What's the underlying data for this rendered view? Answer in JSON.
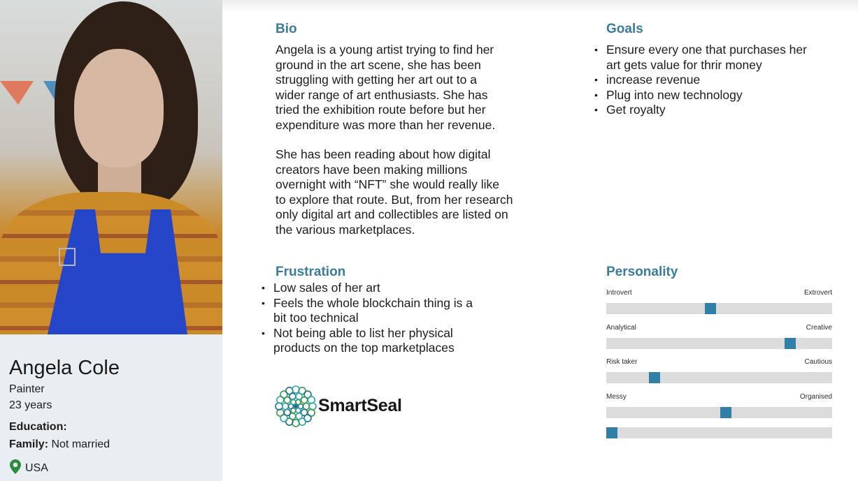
{
  "persona": {
    "name": "Angela Cole",
    "occupation": "Painter",
    "age": "23 years",
    "education_label": "Education:",
    "family_label": "Family:",
    "family_value": "Not married",
    "location": "USA"
  },
  "bio": {
    "heading": "Bio",
    "lines_p1": [
      "Angela is a young artist trying to find her",
      "ground in the art scene, she has been",
      "struggling with getting her art out to a",
      "wider range of art enthusiasts. She has",
      "tried the exhibition route before but her",
      "expenditure was more than her revenue."
    ],
    "lines_p2": [
      "She has been reading about how digital",
      "creators have been making millions",
      "overnight with “NFT” she would really like",
      "to explore that route. But, from her research",
      "only digital art and collectibles are listed on",
      "the various marketplaces."
    ]
  },
  "goals": {
    "heading": "Goals",
    "items": [
      [
        "Ensure every one that purchases her",
        "art gets value for thrir money"
      ],
      [
        "increase revenue"
      ],
      [
        "Plug into new technology"
      ],
      [
        "Get royalty"
      ]
    ]
  },
  "frustration": {
    "heading": "Frustration",
    "items": [
      [
        "Low sales of her art"
      ],
      [
        "Feels the whole blockchain thing is a",
        "bit too technical"
      ],
      [
        "Not being able to list her physical",
        "products on the top marketplaces"
      ]
    ]
  },
  "logo": {
    "text": "SmartSeal",
    "colors": [
      "#2aa6b3",
      "#3a9b4a",
      "#1d6f8e"
    ]
  },
  "personality": {
    "heading": "Personality",
    "accent": "#2f7fa6",
    "sliders": [
      {
        "left": "Introvert",
        "right": "Extrovert",
        "value": 0.46
      },
      {
        "left": "Analytical",
        "right": "Creative",
        "value": 0.83
      },
      {
        "left": "Risk taker",
        "right": "Cautious",
        "value": 0.2
      },
      {
        "left": "Messy",
        "right": "Organised",
        "value": 0.53
      },
      {
        "left": "",
        "right": "",
        "value": 0.0
      }
    ]
  }
}
